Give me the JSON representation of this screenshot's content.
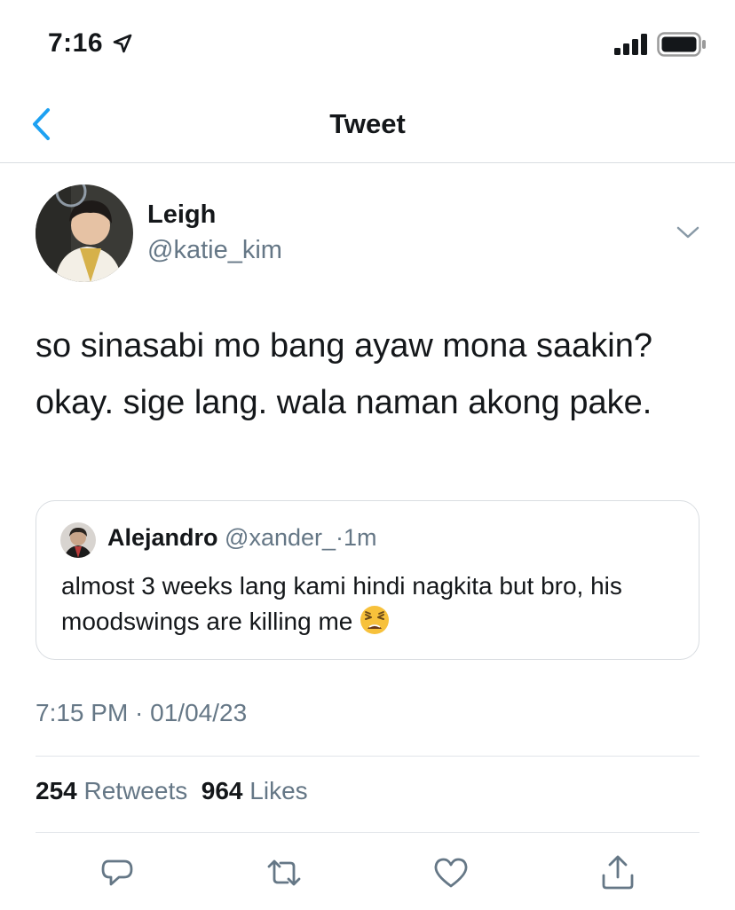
{
  "status_bar": {
    "time": "7:16",
    "icons": [
      "location-arrow-icon",
      "cellular-signal-icon",
      "battery-icon"
    ]
  },
  "nav": {
    "title": "Tweet",
    "back_icon": "chevron-left-icon"
  },
  "tweet": {
    "author": {
      "name": "Leigh",
      "handle": "@katie_kim"
    },
    "text": "so sinasabi mo bang ayaw mona saakin? okay. sige lang. wala naman akong pake.",
    "quoted": {
      "author_name": "Alejandro",
      "author_handle": "@xander_",
      "separator": "·",
      "time_ago": "1m",
      "text": "almost 3 weeks lang kami hindi nagkita but bro, his moodswings are killing me",
      "emoji": "weary-face-emoji"
    },
    "timestamp": "7:15 PM · 01/04/23",
    "retweets_count": "254",
    "retweets_label": "Retweets",
    "likes_count": "964",
    "likes_label": "Likes"
  },
  "actions": [
    "reply-icon",
    "retweet-icon",
    "like-icon",
    "share-icon"
  ],
  "colors": {
    "accent": "#1da1f2",
    "text_primary": "#14171a",
    "text_secondary": "#657786",
    "divider": "#e1e5e9"
  }
}
